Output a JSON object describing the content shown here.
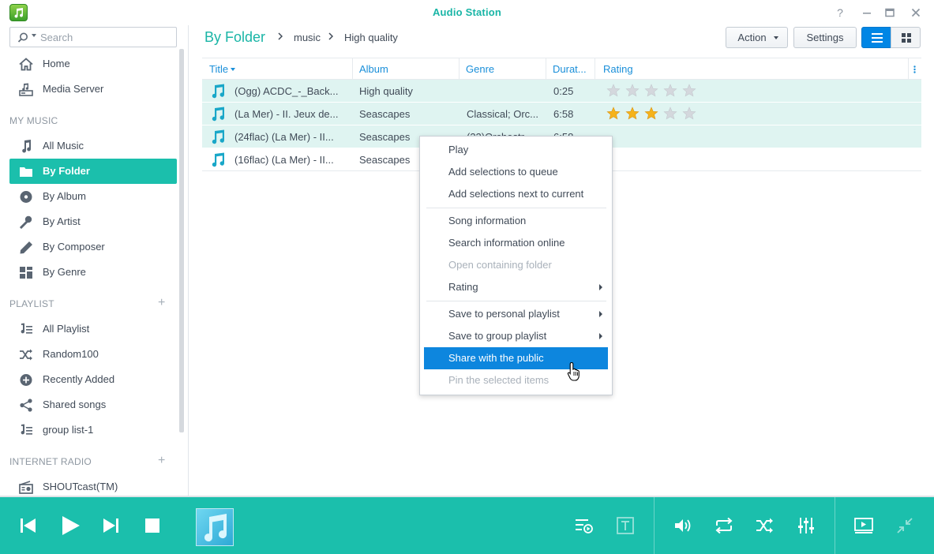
{
  "window": {
    "title": "Audio Station"
  },
  "search": {
    "placeholder": "Search"
  },
  "sidebar": {
    "top_items": [
      {
        "label": "Home",
        "icon": "home-icon"
      },
      {
        "label": "Media Server",
        "icon": "media-server-icon"
      }
    ],
    "my_music": {
      "header": "MY MUSIC",
      "items": [
        {
          "label": "All Music",
          "icon": "music-note-icon"
        },
        {
          "label": "By Folder",
          "icon": "folder-icon",
          "active": true
        },
        {
          "label": "By Album",
          "icon": "album-icon"
        },
        {
          "label": "By Artist",
          "icon": "microphone-icon"
        },
        {
          "label": "By Composer",
          "icon": "pen-icon"
        },
        {
          "label": "By Genre",
          "icon": "grid-icon"
        }
      ]
    },
    "playlist": {
      "header": "PLAYLIST",
      "add": "+",
      "items": [
        {
          "label": "All Playlist",
          "icon": "playlist-icon"
        },
        {
          "label": "Random100",
          "icon": "shuffle-icon"
        },
        {
          "label": "Recently Added",
          "icon": "add-circle-icon"
        },
        {
          "label": "Shared songs",
          "icon": "share-icon"
        },
        {
          "label": "group list-1",
          "icon": "playlist-icon"
        }
      ]
    },
    "internet_radio": {
      "header": "INTERNET RADIO",
      "add": "+",
      "items": [
        {
          "label": "SHOUTcast(TM)",
          "icon": "radio-icon"
        }
      ]
    }
  },
  "breadcrumb": {
    "root": "By Folder",
    "parts": [
      "music",
      "High quality"
    ]
  },
  "toolbar": {
    "action_label": "Action",
    "settings_label": "Settings"
  },
  "table": {
    "columns": [
      "Title",
      "Album",
      "Genre",
      "Durat...",
      "Rating"
    ],
    "rows": [
      {
        "title": "(Ogg) ACDC_-_Back...",
        "album": "High quality",
        "genre": "",
        "duration": "0:25",
        "rating": 0,
        "selected": true
      },
      {
        "title": "(La Mer) - II. Jeux de...",
        "album": "Seascapes",
        "genre": "Classical; Orc...",
        "duration": "6:58",
        "rating": 3,
        "selected": true
      },
      {
        "title": "(24flac) (La Mer) - II...",
        "album": "Seascapes",
        "genre": "(32)Orchestr...",
        "duration": "6:58",
        "rating": 0,
        "selected": true
      },
      {
        "title": "(16flac) (La Mer) - II...",
        "album": "Seascapes",
        "genre": "",
        "duration": "",
        "rating": 0,
        "selected": false
      }
    ]
  },
  "context_menu": {
    "items": [
      {
        "label": "Play"
      },
      {
        "label": "Add selections to queue"
      },
      {
        "label": "Add selections next to current"
      },
      {
        "label": "Song information"
      },
      {
        "label": "Search information online"
      },
      {
        "label": "Open containing folder",
        "disabled": true
      },
      {
        "label": "Rating",
        "submenu": true
      },
      {
        "label": "Save to personal playlist",
        "submenu": true
      },
      {
        "label": "Save to group playlist",
        "submenu": true
      },
      {
        "label": "Share with the public",
        "highlighted": true
      },
      {
        "label": "Pin the selected items",
        "disabled": true
      }
    ]
  },
  "colors": {
    "accent": "#1bbfac",
    "link": "#1a8fd9",
    "highlight": "#0d86de",
    "star": "#f5b31b"
  }
}
